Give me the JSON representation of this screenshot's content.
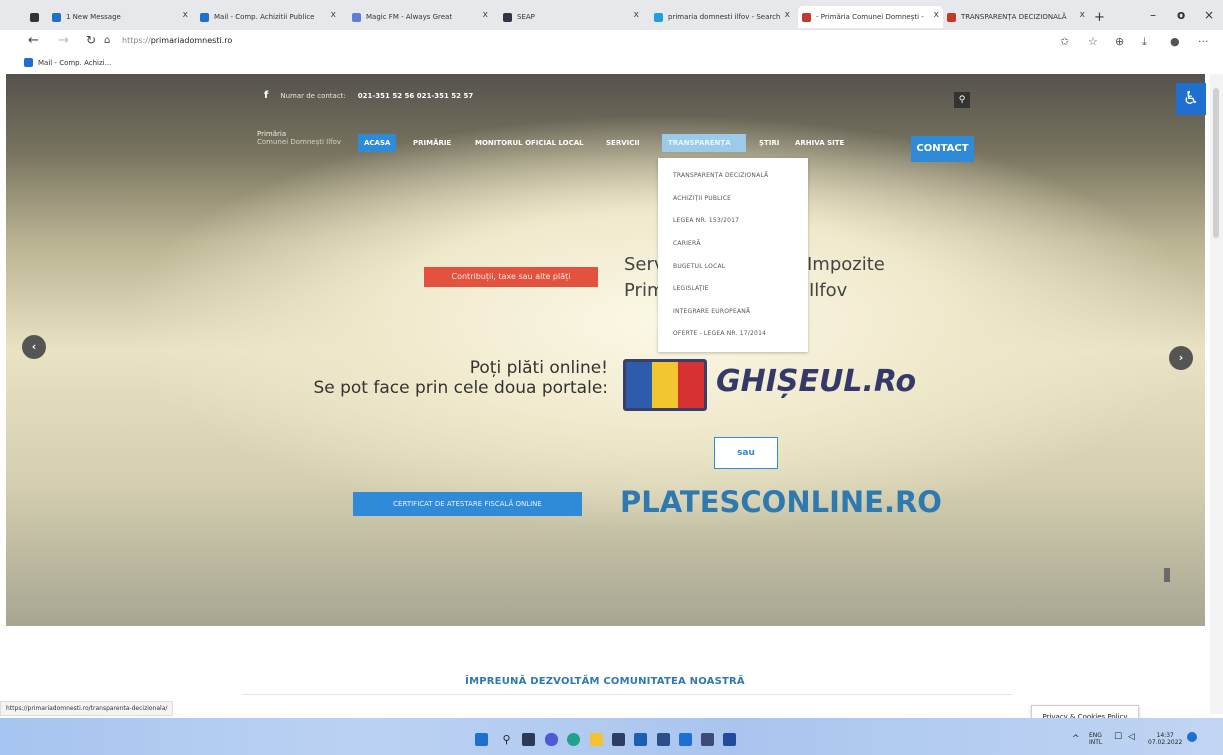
{
  "browser": {
    "tabs": [
      {
        "title": "1 New Message"
      },
      {
        "title": "Mail - Comp. Achizitii Publice"
      },
      {
        "title": "Magic FM - Always Great"
      },
      {
        "title": "SEAP"
      },
      {
        "title": "primaria domnesti ilfov - Search"
      },
      {
        "title": "- Primăria Comunei Domnești -"
      },
      {
        "title": "TRANSPARENȚA DECIZIONALĂ"
      }
    ],
    "new_tab": "+",
    "url_scheme": "https://",
    "url_host": "primariadomnesti.ro",
    "favorites": [
      {
        "label": "Mail - Comp. Achizi..."
      }
    ],
    "status_url": "https://primariadomnesti.ro/transparenta-decizionala/"
  },
  "site": {
    "contact_label": "Numar de contact:",
    "phones": "021-351 52 56   021-351 52 57",
    "logo_line1": "Primăria",
    "logo_line2": "Comunei Domnești  Ilfov",
    "menu": [
      "ACASA",
      "PRIMĂRIE",
      "MONITORUL OFICIAL LOCAL",
      "SERVICII",
      "TRANSPARENȚA",
      "ȘTIRI",
      "ARHIVA SITE"
    ],
    "contact_button": "CONTACT",
    "dropdown": [
      "TRANSPARENȚA DECIZIONALĂ",
      "ACHIZIȚII PUBLICE",
      "LEGEA NR. 153/2017",
      "CARIERĂ",
      "BUGETUL LOCAL",
      "LEGISLAȚIE",
      "INTEGRARE EUROPEANĂ",
      "OFERTE - LEGEA NR. 17/2014"
    ],
    "taxes_button": "Contribuții, taxe sau alte plăți",
    "heading_left_1": "Serv",
    "heading_left_2": "Prim",
    "heading_right_1": "Impozite",
    "heading_right_2": "Ilfov",
    "pay_line1": "Poți plăti online!",
    "pay_line2": "Se pot face prin cele doua portale:",
    "ghiseul": "GHIȘEUL.Ro",
    "sau": "sau",
    "certificate_button": "CERTIFICAT DE ATESTARE FISCALĂ ONLINE",
    "platesc": "PLATESCONLINE.RO",
    "prev_arrow": "‹",
    "next_arrow": "›",
    "community": "ÎMPREUNĂ DEZVOLTĂM COMUNITATEA NOASTRĂ",
    "privacy": "Privacy & Cookies Policy"
  },
  "taskbar": {
    "lang1": "ENG",
    "lang2": "INTL",
    "time": "14:37",
    "date": "07.02.2022"
  },
  "colors": {
    "accent_blue": "#2f8ad8",
    "red_button": "#e4523f",
    "plates_blue": "#2e7ab0",
    "ghiseul_navy": "#35396a"
  }
}
